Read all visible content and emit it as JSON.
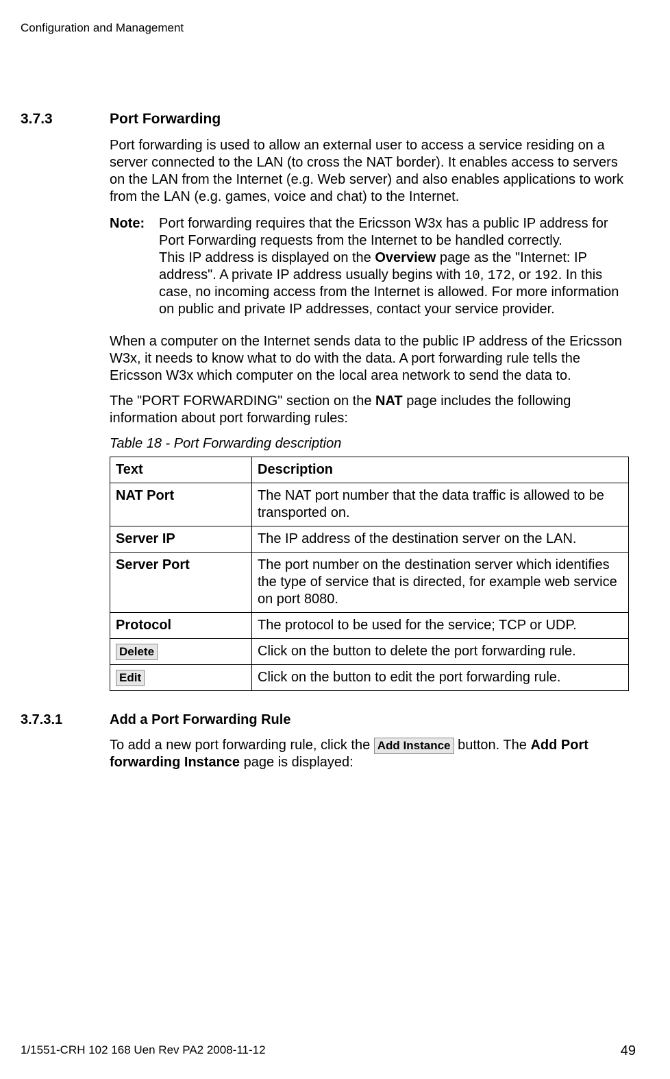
{
  "header": {
    "running": "Configuration and Management"
  },
  "section": {
    "number": "3.7.3",
    "title": "Port Forwarding",
    "intro": "Port forwarding is used to allow an external user to access a service residing on a server connected to the LAN (to cross the NAT border). It enables access to servers on the LAN from the Internet (e.g. Web server) and also enables applications to work from the LAN (e.g. games, voice and chat) to the Internet.",
    "note_label": "Note:",
    "note_part1": "Port forwarding requires that the Ericsson W3x has a public IP address for Port Forwarding requests from the Internet to be handled correctly.",
    "note_part2a": "This IP address is displayed on the ",
    "note_overview": "Overview",
    "note_part2b": " page as the \"Internet: IP address\". A private IP address usually begins with ",
    "note_ip10": "10",
    "note_comma1": ", ",
    "note_ip172": "172",
    "note_or": ", or ",
    "note_ip192": "192",
    "note_part2c": ". In this case, no incoming access from the Internet is allowed. For more information on public and private IP addresses, contact your service provider.",
    "para2": "When a computer on the Internet sends data to the public IP address of the Ericsson W3x, it needs to know what to do with the data. A port forwarding rule tells the Ericsson W3x which computer on the local area network to send the data to.",
    "para3a": "The \"PORT FORWARDING\" section on the ",
    "para3_nat": "NAT",
    "para3b": " page includes the following information about port forwarding rules:",
    "table_caption": "Table 18 - Port Forwarding description",
    "table": {
      "head_text": "Text",
      "head_desc": "Description",
      "rows": [
        {
          "text_label": "NAT Port",
          "is_button": false,
          "desc": "The NAT port number that the data traffic is allowed to be transported on."
        },
        {
          "text_label": "Server IP",
          "is_button": false,
          "desc": "The IP address of the destination server on the LAN."
        },
        {
          "text_label": "Server Port",
          "is_button": false,
          "desc": "The port number on the destination server which identifies the type of service that is directed, for example web service on port 8080."
        },
        {
          "text_label": "Protocol",
          "is_button": false,
          "desc": "The protocol to be used for the service; TCP or UDP."
        },
        {
          "text_label": "Delete",
          "is_button": true,
          "desc": "Click on the button to delete the port forwarding rule."
        },
        {
          "text_label": "Edit",
          "is_button": true,
          "desc": "Click on the button to edit the port forwarding rule."
        }
      ]
    }
  },
  "subsection": {
    "number": "3.7.3.1",
    "title": "Add a Port Forwarding Rule",
    "body_a": "To add a new port forwarding rule, click the ",
    "button_label": "Add Instance",
    "body_b": " button. The ",
    "bold_text": "Add Port forwarding Instance",
    "body_c": " page is displayed:"
  },
  "footer": {
    "docid": "1/1551-CRH 102 168 Uen Rev PA2  2008-11-12",
    "page": "49"
  }
}
